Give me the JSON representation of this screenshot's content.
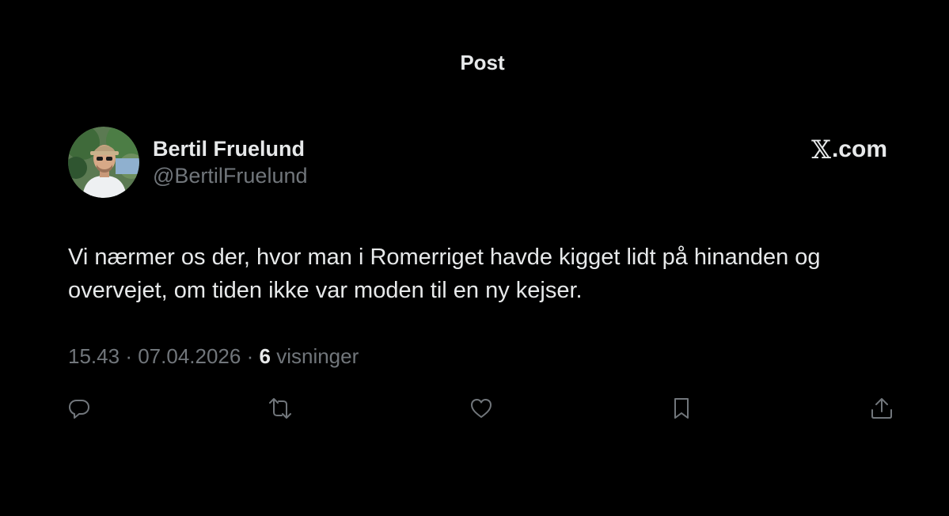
{
  "header": {
    "title": "Post"
  },
  "author": {
    "display_name": "Bertil Fruelund",
    "handle": "@BertilFruelund"
  },
  "brand": {
    "x_glyph": "𝕏",
    "suffix": ".com"
  },
  "tweet": {
    "text": "Vi nærmer os der, hvor man i Romerriget havde kigget lidt på hinanden og overvejet, om tiden ikke var moden til en ny kejser."
  },
  "meta": {
    "time": "15.43",
    "separator": "·",
    "date": "07.04.2026",
    "views_count": "6",
    "views_label": "visninger"
  },
  "actions": {
    "reply_icon": "reply-icon",
    "repost_icon": "repost-icon",
    "like_icon": "heart-icon",
    "bookmark_icon": "bookmark-icon",
    "share_icon": "share-icon"
  },
  "colors": {
    "background": "#000000",
    "primary_text": "#e7e9ea",
    "secondary_text": "#71767b"
  }
}
